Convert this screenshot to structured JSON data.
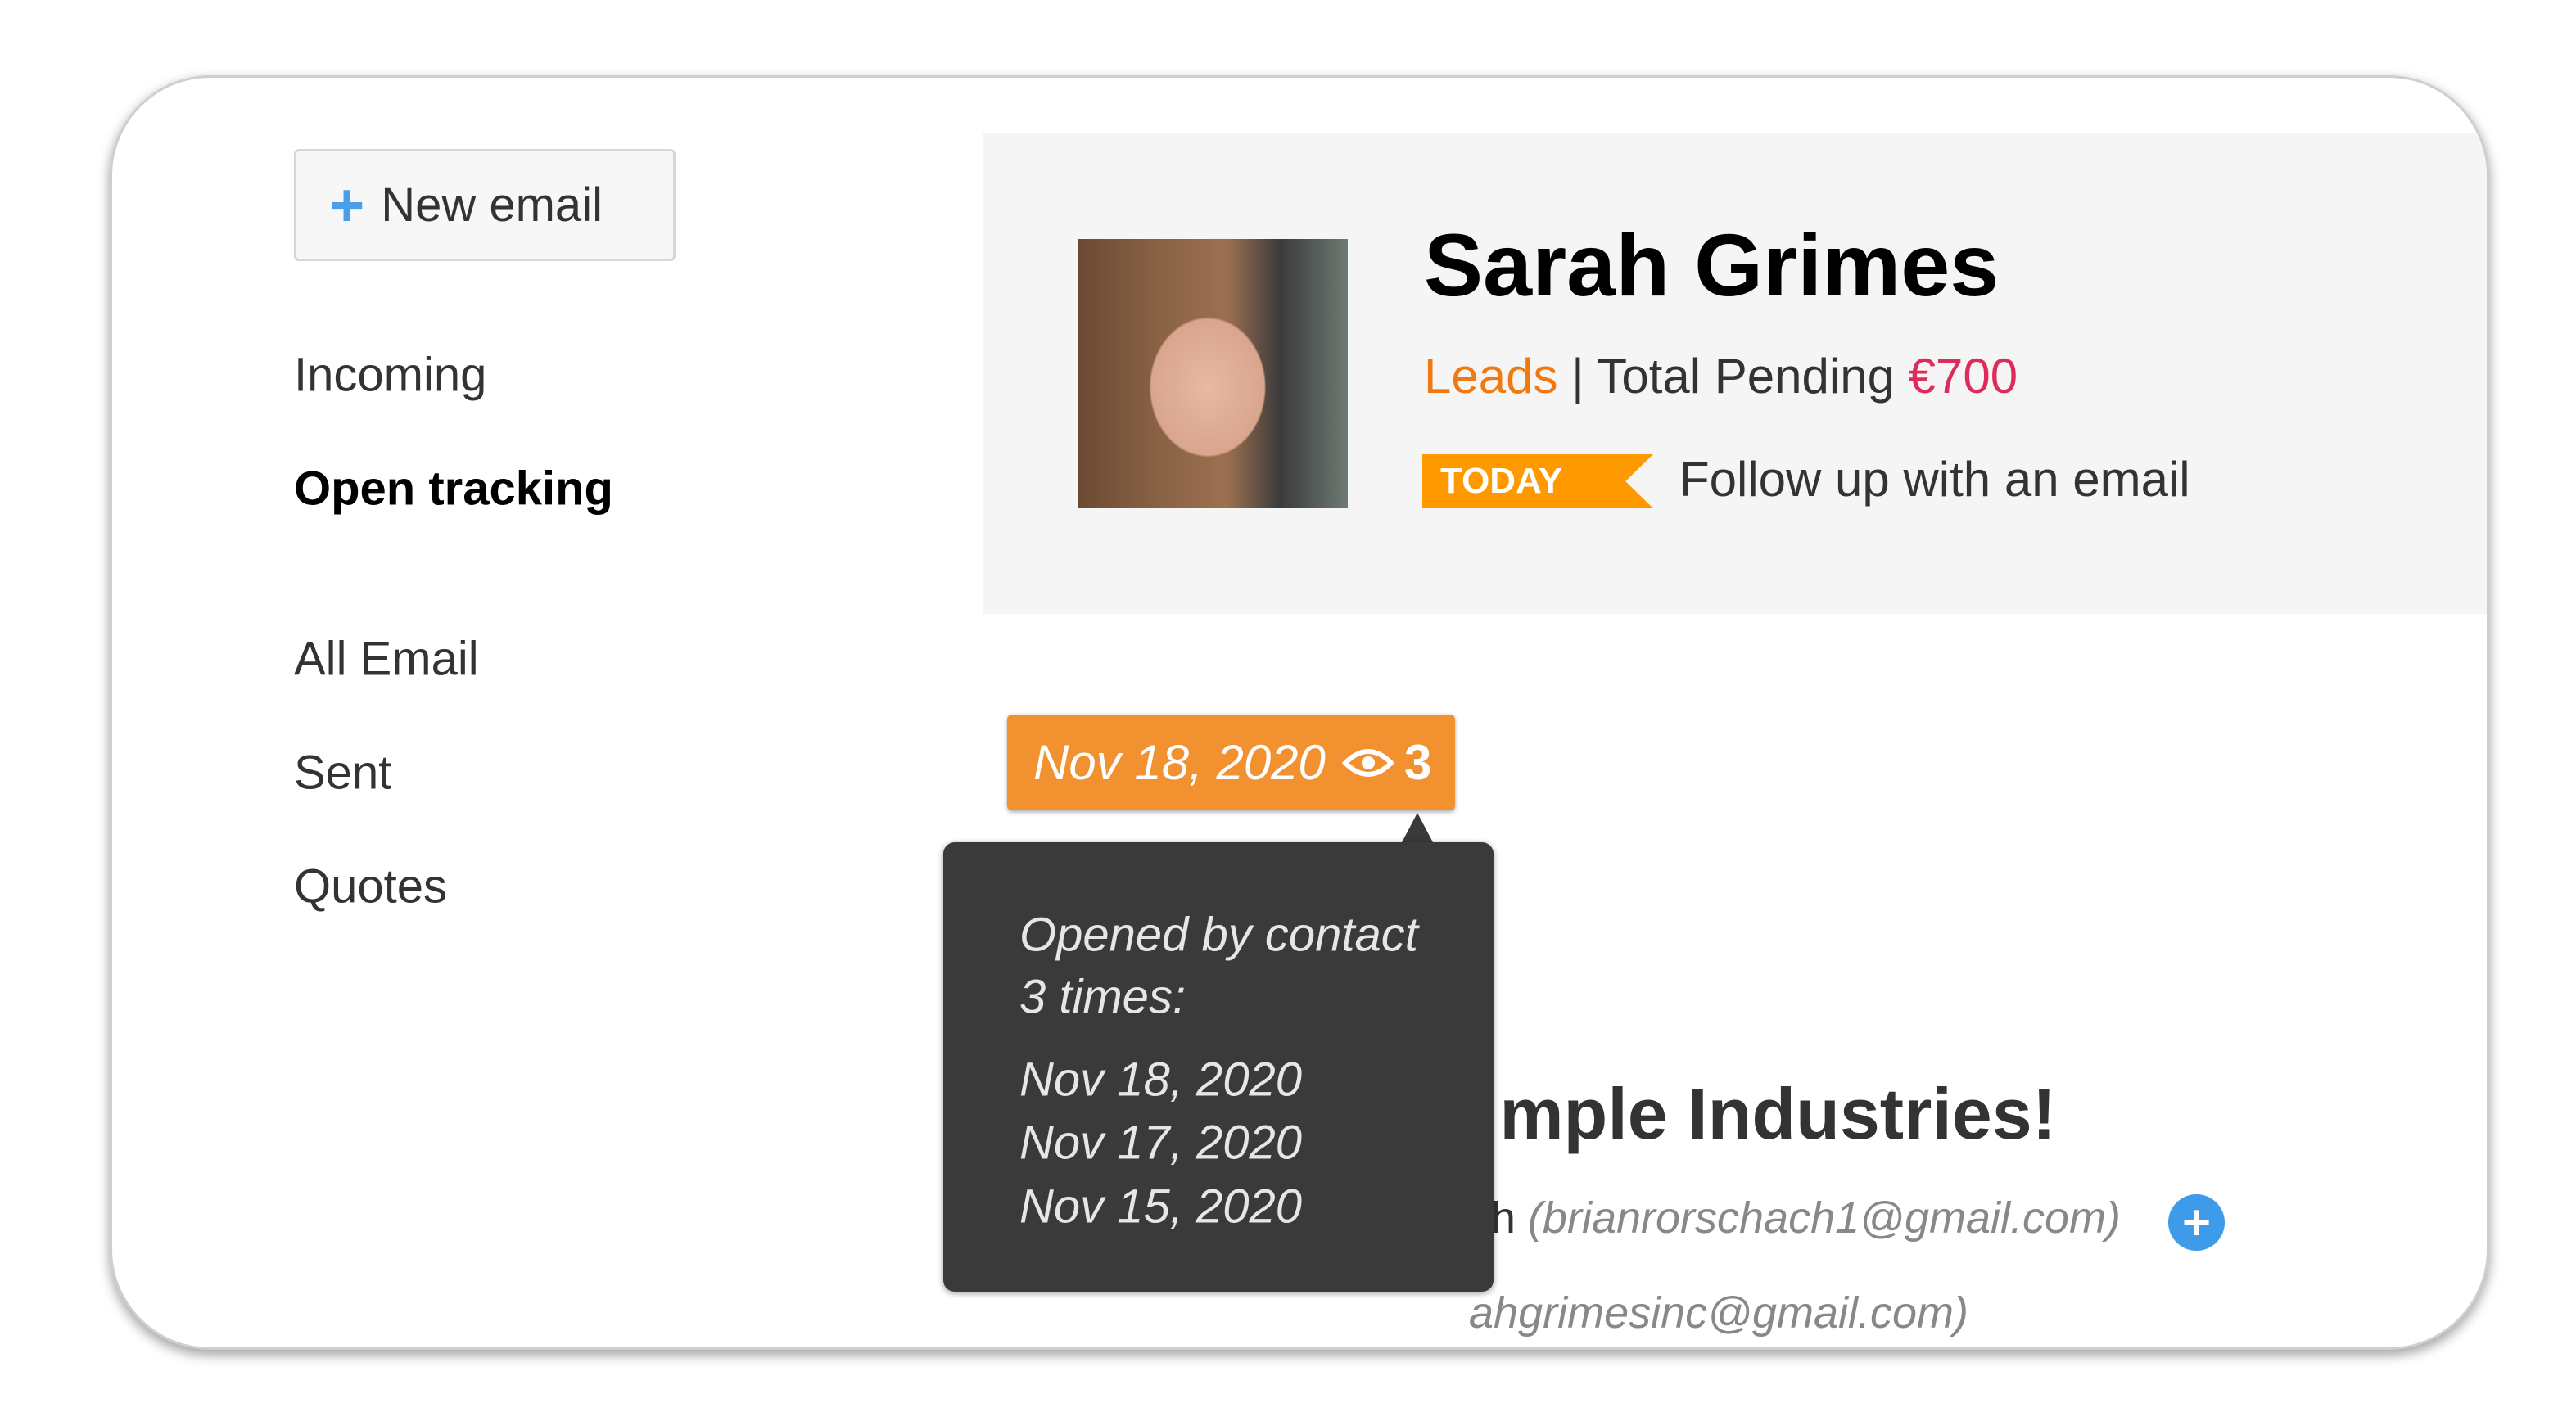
{
  "sidebar": {
    "new_email_label": "New email",
    "items": [
      {
        "label": "Incoming",
        "active": false
      },
      {
        "label": "Open tracking",
        "active": true
      },
      {
        "label": "All Email",
        "active": false
      },
      {
        "label": "Sent",
        "active": false
      },
      {
        "label": "Quotes",
        "active": false
      }
    ]
  },
  "contact": {
    "name": "Sarah Grimes",
    "stage": "Leads",
    "separator": "|",
    "pending_label": "Total Pending",
    "pending_amount": "€700",
    "task_badge": "TODAY",
    "task_text": "Follow up with an email"
  },
  "email": {
    "subject_visible": "mple Industries!",
    "from_visible": "h",
    "from_email": "(brianrorschach1@gmail.com)",
    "to_visible": "ahgrimesinc@gmail.com)",
    "add_icon": "plus-circle-icon"
  },
  "tracking": {
    "date": "Nov 18, 2020",
    "icon": "eye-icon",
    "open_count": "3",
    "tooltip_line1": "Opened by contact",
    "tooltip_line2": "3 times:",
    "opens": [
      "Nov 18, 2020",
      "Nov 17, 2020",
      "Nov 15, 2020"
    ]
  },
  "colors": {
    "accent_orange": "#f29130",
    "today_orange": "#ff9900",
    "leads": "#f07a12",
    "amount": "#dd2b5b",
    "tooltip_bg": "#3a3a3a",
    "add_blue": "#3e9be9"
  }
}
